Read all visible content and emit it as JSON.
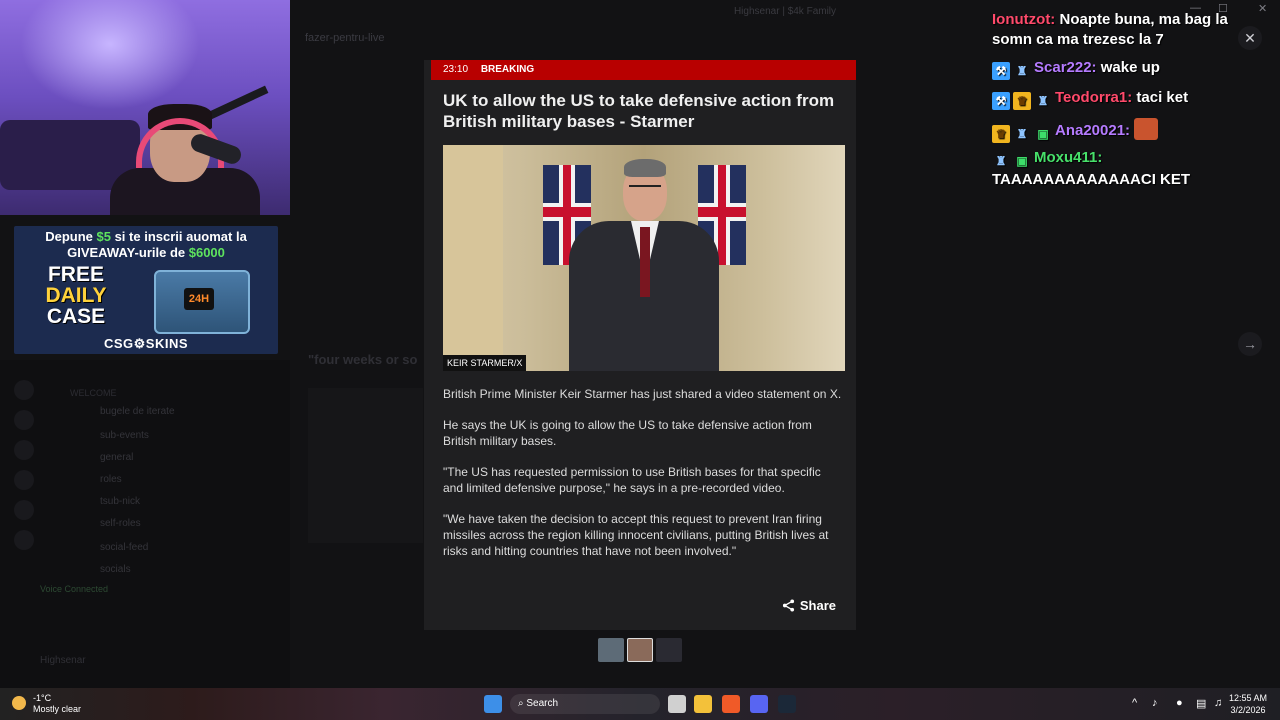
{
  "background": {
    "top_title": "Highsenar | $4k Family",
    "channel_name": "fazer-pentru-live",
    "channels": [
      "bugele de iterate",
      "sub-events",
      "general",
      "roles",
      "tsub-nick",
      "self-roles",
      "social-feed",
      "socials"
    ],
    "categories": [
      "WELCOME"
    ],
    "voice_status": "Voice Connected",
    "user_name": "Highsenar",
    "post_title": "\"four weeks or so",
    "window_controls": [
      "—",
      "☐",
      "✕"
    ]
  },
  "sponsor": {
    "line1_a": "Depune ",
    "line1_amount": "$5",
    "line1_b": " si te inscrii auomat la",
    "line2_a": "GIVEAWAY-urile de ",
    "line2_amount": "$6000",
    "free": "FREE",
    "daily": "DAILY",
    "case": "CASE",
    "crate_label": "24H",
    "brand": "CSG⚙SKINS"
  },
  "chat": [
    {
      "user": "Ionutzot:",
      "color": "#ff4a6b",
      "text": "Noapte buna, ma bag la somn ca ma trezesc la 7",
      "badges": []
    },
    {
      "user": "Scar222:",
      "color": "#b57bff",
      "text": "wake up",
      "badges": [
        "mod",
        "bot"
      ]
    },
    {
      "user": "Teodorra1:",
      "color": "#ff4a6b",
      "text": "taci ket",
      "badges": [
        "mod",
        "crown",
        "bot"
      ]
    },
    {
      "user": "Ana20021:",
      "color": "#b57bff",
      "text": "",
      "badges": [
        "crown",
        "bot",
        "gift"
      ],
      "emote": true
    },
    {
      "user": "Moxu411:",
      "color": "#47e06a",
      "text": "TAAAAAAAAAAAAACI KET",
      "badges": [
        "bot",
        "gift"
      ]
    }
  ],
  "article": {
    "time": "23:10",
    "label": "BREAKING",
    "headline": "UK to allow the US to take defensive action from British military bases - Starmer",
    "photo_credit": "KEIR STARMER/X",
    "paragraphs": [
      "British Prime Minister Keir Starmer has just shared a video statement on X.",
      "He says the UK is going to allow the US to take defensive action from British military bases.",
      "\"The US has requested permission to use British bases for that specific and limited defensive purpose,\" he says in a pre-recorded video.",
      "\"We have taken the decision to accept this request to prevent Iran firing missiles across the region killing innocent civilians, putting British lives at risks and hitting countries that have not been involved.\""
    ],
    "share_label": "Share"
  },
  "taskbar": {
    "temperature": "-1°C",
    "weather_desc": "Mostly clear",
    "search_label": "Search",
    "time": "12:55 AM",
    "date": "3/2/2026"
  },
  "colors": {
    "breaking_red": "#b80000",
    "modal_bg": "#1f1f21"
  }
}
